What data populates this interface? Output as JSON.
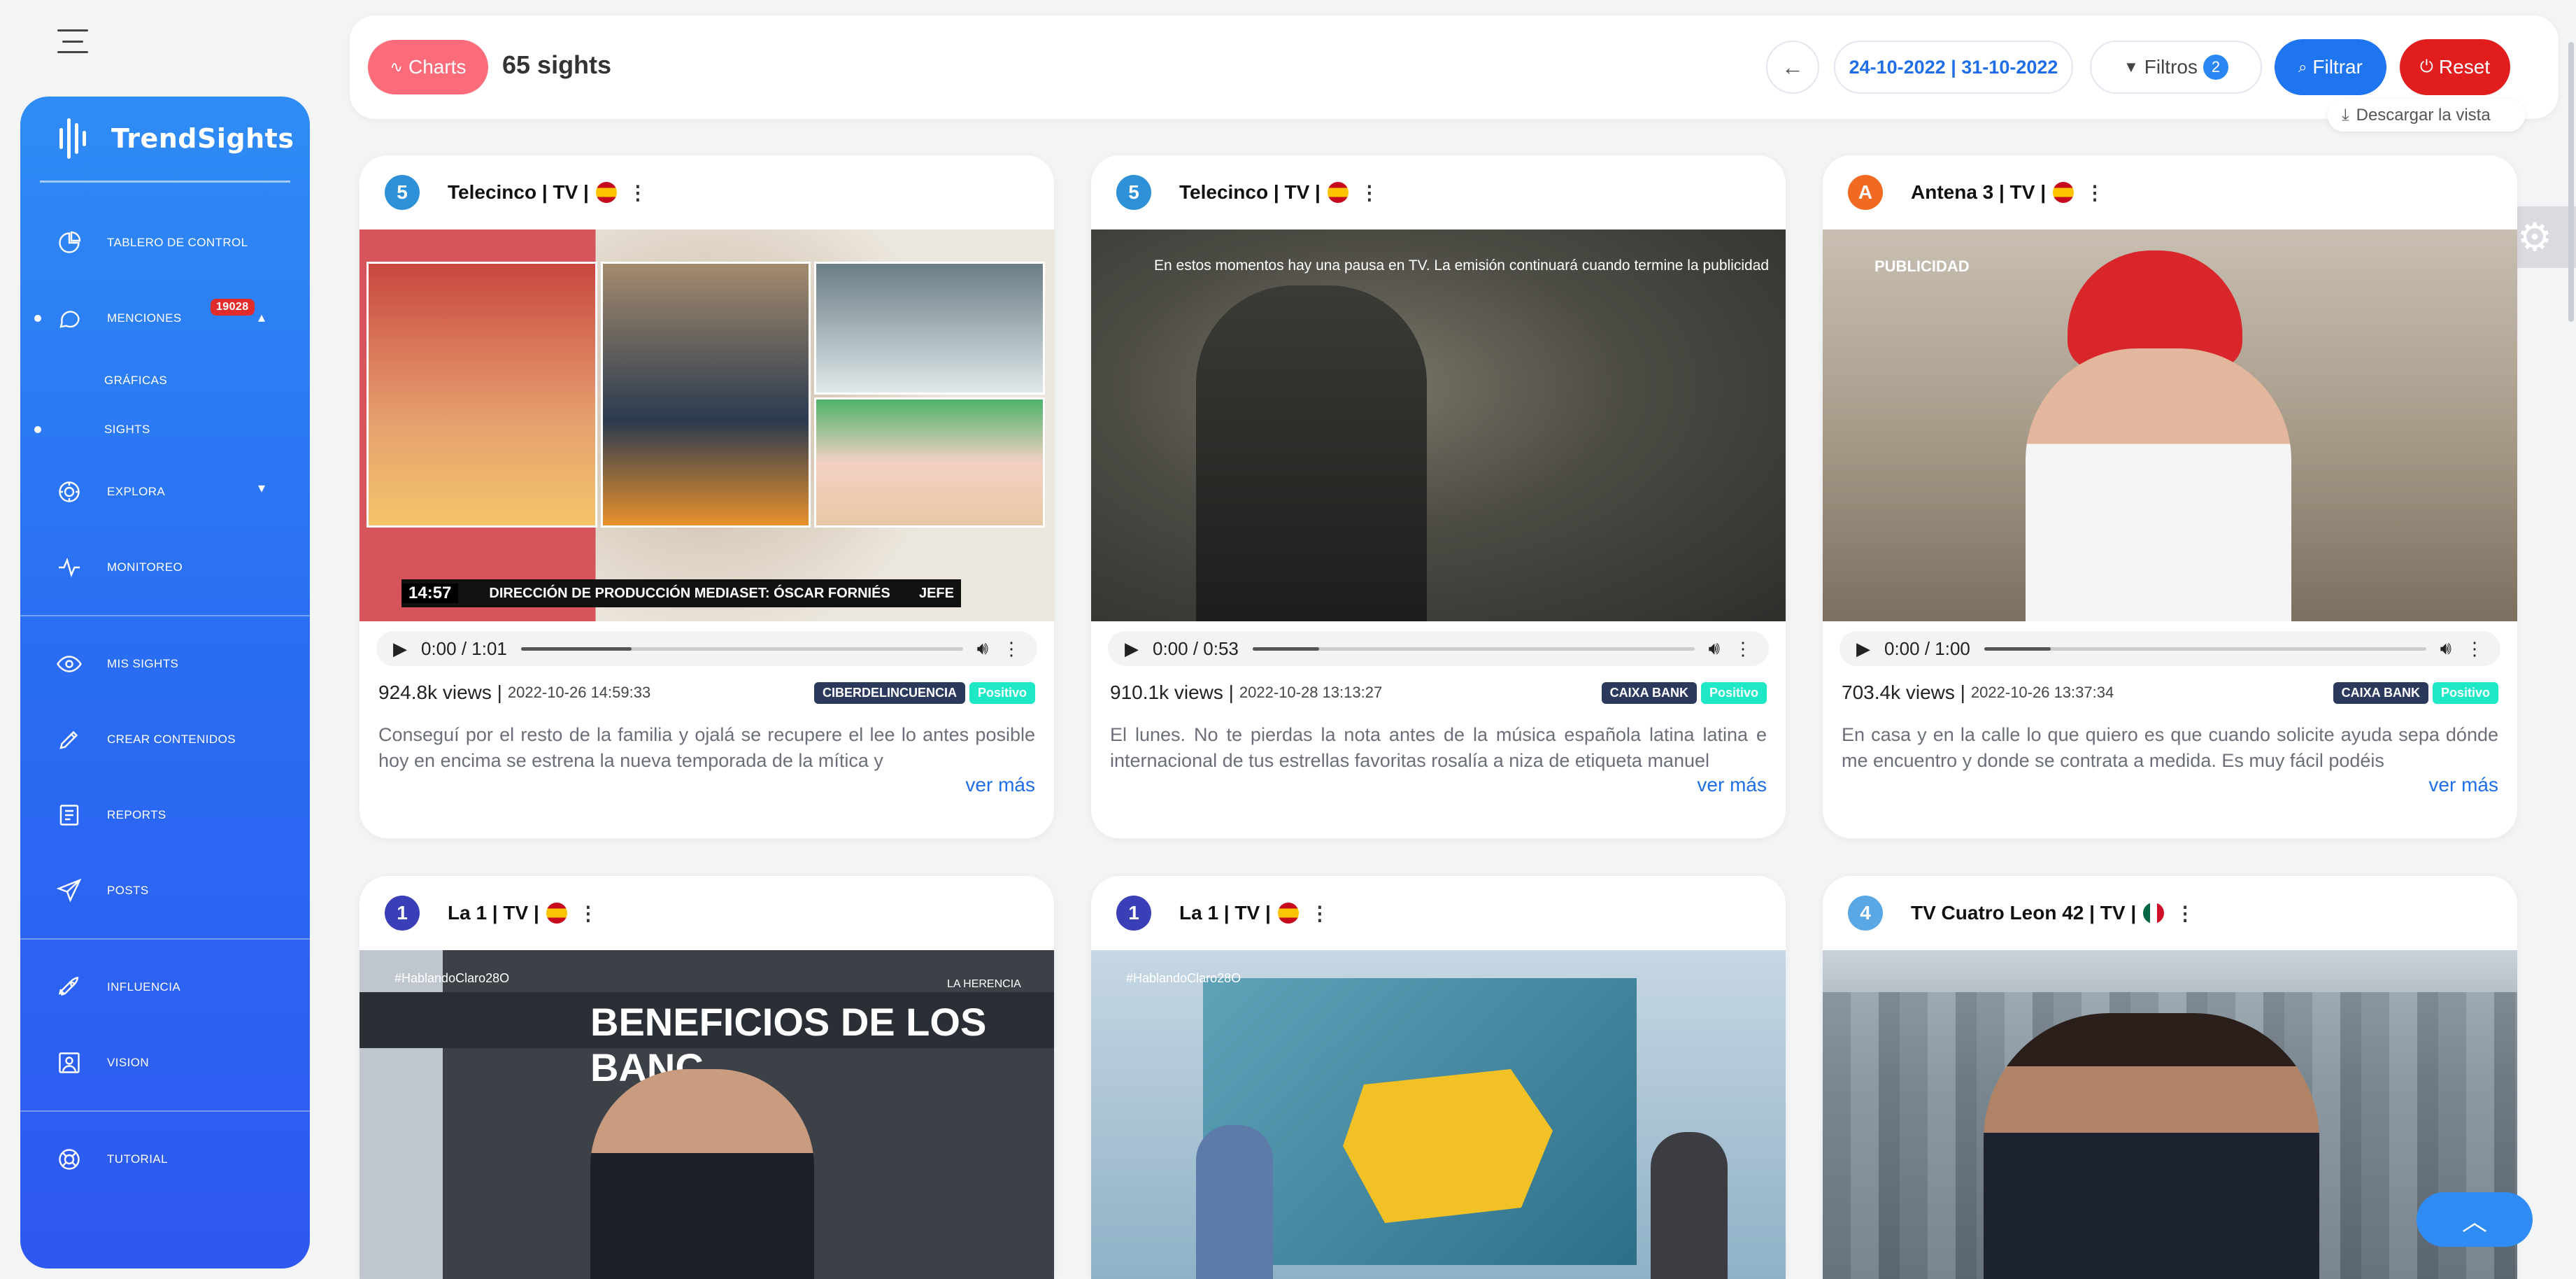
{
  "sidebar": {
    "brand": "TrendSights",
    "items": [
      {
        "label": "TABLERO DE CONTROL",
        "icon": "dashboard-icon"
      },
      {
        "label": "MENCIONES",
        "icon": "chat-icon",
        "badge": "19028"
      },
      {
        "label": "GRÁFICAS",
        "sub": true
      },
      {
        "label": "SIGHTS",
        "sub": true,
        "active": true
      },
      {
        "label": "EXPLORA",
        "icon": "explore-icon"
      },
      {
        "label": "MONITOREO",
        "icon": "pulse-icon"
      },
      {
        "label": "MIS SIGHTS",
        "icon": "eye-icon"
      },
      {
        "label": "CREAR CONTENIDOS",
        "icon": "pencil-icon"
      },
      {
        "label": "REPORTS",
        "icon": "report-icon"
      },
      {
        "label": "POSTS",
        "icon": "send-icon"
      },
      {
        "label": "INFLUENCIA",
        "icon": "rocket-icon"
      },
      {
        "label": "VISION",
        "icon": "image-icon"
      },
      {
        "label": "TUTORIAL",
        "icon": "lifebuoy-icon"
      }
    ]
  },
  "topbar": {
    "charts_label": "Charts",
    "count_label": "65 sights",
    "date_range": "24-10-2022 | 31-10-2022",
    "filters_label": "Filtros",
    "filters_count": "2",
    "filter_button": "Filtrar",
    "reset_button": "Reset",
    "download_label": "Descargar la vista"
  },
  "cards": [
    {
      "channel": "Telecinco | TV |",
      "logo": "5",
      "logo_color": "#2e90d6",
      "flag": "es",
      "time": "0:00 / 1:01",
      "progress": 0.25,
      "views": "924.8k views |",
      "date": "2022-10-26 14:59:33",
      "topic": "CIBERDELINCUENCIA",
      "sentiment": "Positivo",
      "text": "Conseguí por el resto de la familia y ojalá se recupere el lee lo antes posible hoy en encima se estrena la nueva temporada de la mítica y",
      "more": "ver más",
      "overlay_clock": "14:57",
      "overlay_ticker": "DIRECCIÓN DE PRODUCCIÓN MEDIASET: ÓSCAR FORNIÉS",
      "overlay_tag": "JEFE"
    },
    {
      "channel": "Telecinco | TV |",
      "logo": "5",
      "logo_color": "#2e90d6",
      "flag": "es",
      "time": "0:00 / 0:53",
      "progress": 0.15,
      "views": "910.1k views |",
      "date": "2022-10-28 13:13:27",
      "topic": "CAIXA BANK",
      "sentiment": "Positivo",
      "text": "El lunes. No te pierdas la nota antes de la música española latina latina e internacional de tus estrellas favoritas rosalía a niza de etiqueta manuel",
      "more": "ver más",
      "overlay_notice": "En estos momentos hay una pausa en TV. La emisión continuará cuando termine la publicidad"
    },
    {
      "channel": "Antena 3 | TV |",
      "logo": "A",
      "logo_color": "#f26a21",
      "flag": "es",
      "time": "0:00 / 1:00",
      "progress": 0.15,
      "views": "703.4k views |",
      "date": "2022-10-26 13:37:34",
      "topic": "CAIXA BANK",
      "sentiment": "Positivo",
      "text": "En casa y en la calle lo que quiero es que cuando solicite ayuda sepa dónde me encuentro y donde se contrata a medida. Es muy fácil podéis",
      "more": "ver más",
      "overlay_tag": "PUBLICIDAD"
    },
    {
      "channel": "La 1 | TV |",
      "logo": "1",
      "logo_color": "#3a3fb8",
      "flag": "es",
      "overlay_title": "BENEFICIOS DE LOS BANC",
      "overlay_hashtag": "#HablandoClaro28O",
      "overlay_show": "LA HERENCIA"
    },
    {
      "channel": "La 1 | TV |",
      "logo": "1",
      "logo_color": "#3a3fb8",
      "flag": "es",
      "overlay_hashtag": "#HablandoClaro28O"
    },
    {
      "channel": "TV Cuatro Leon 42 | TV |",
      "logo": "4",
      "logo_color": "#5aa7e6",
      "flag": "mx"
    }
  ]
}
